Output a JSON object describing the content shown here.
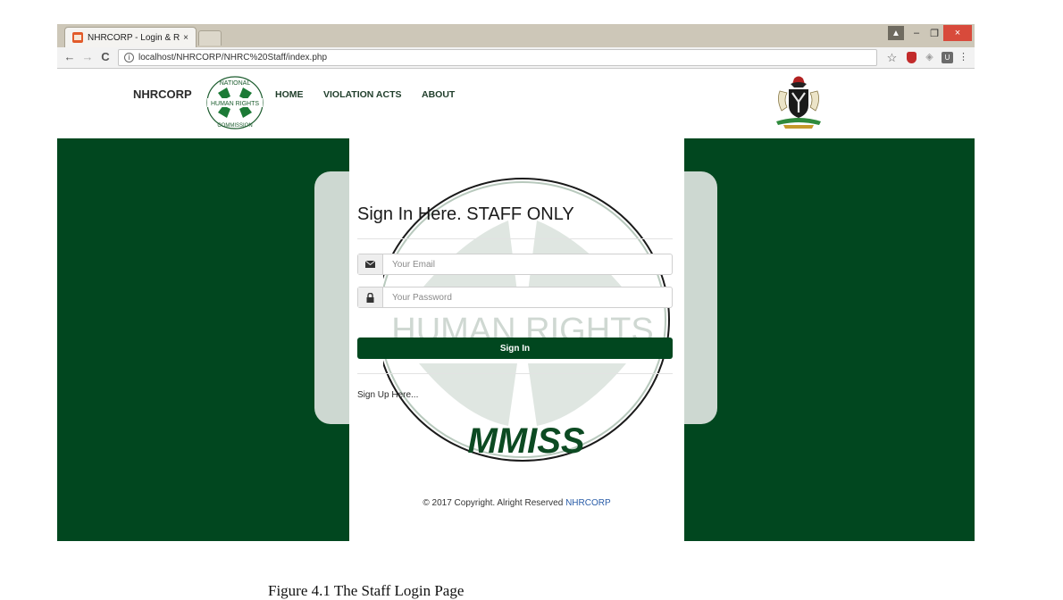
{
  "browser": {
    "tab_title": "NHRCORP - Login & Reg",
    "tab_close": "×",
    "url": "localhost/NHRCORP/NHRC%20Staff/index.php",
    "back_icon": "←",
    "forward_icon": "→",
    "reload_icon": "C",
    "info_icon": "i",
    "star_icon": "☆",
    "menu_icon": "⋮",
    "ext_u_label": "U",
    "window_controls": {
      "minimize": "–",
      "restore": "❐",
      "close": "×"
    }
  },
  "header": {
    "brand": "NHRCORP",
    "nav": [
      {
        "label": "HOME"
      },
      {
        "label": "VIOLATION ACTS"
      },
      {
        "label": "ABOUT"
      }
    ],
    "logo_text": {
      "top": "NATIONAL",
      "middle": "HUMAN RIGHTS",
      "bottom": "COMMISSION"
    }
  },
  "login": {
    "title": "Sign In Here. STAFF ONLY",
    "email_placeholder": "Your Email",
    "password_placeholder": "Your Password",
    "submit_label": "Sign In",
    "signup_link": "Sign Up Here..."
  },
  "watermark": {
    "text": "HUMAN RIGHTS",
    "bottom": "MMISS"
  },
  "footer": {
    "text": "© 2017 Copyright. Alright Reserved",
    "brand_link": "NHRCORP"
  },
  "caption": "Figure 4.1        The Staff Login Page",
  "colors": {
    "brand_green": "#01471f",
    "panel_grey": "#cdd8d1",
    "link_blue": "#2a5da8",
    "close_red": "#d84a3b"
  }
}
